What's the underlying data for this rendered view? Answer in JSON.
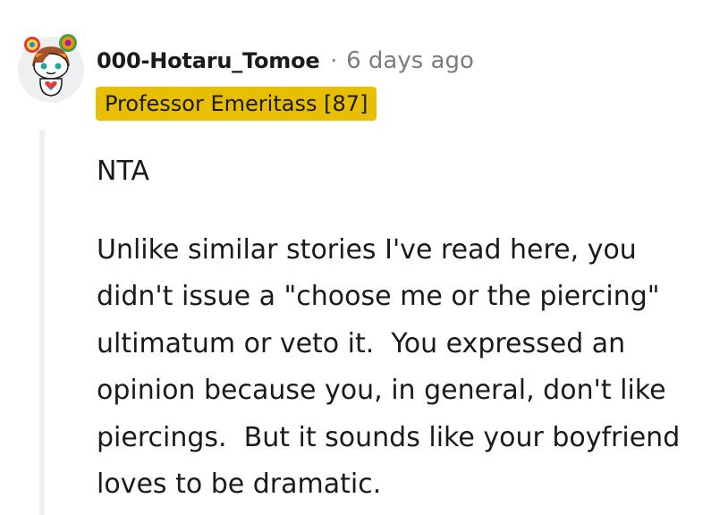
{
  "comment": {
    "author": "000-Hotaru_Tomoe",
    "separator": "·",
    "timestamp": "6 days ago",
    "flair": "Professor Emeritass [87]",
    "paragraphs": [
      "NTA",
      "Unlike similar stories I've read here, you didn't issue a \"choose me or the piercing\" ultimatum or veto it.  You expressed an opinion because you, in general, don't like piercings.  But it sounds like your boyfriend loves to be dramatic."
    ]
  },
  "avatar": {
    "icon": "reddit-snoo-avatar-icon",
    "hair_colors": [
      "#e53935",
      "#fb8c00",
      "#fdd835",
      "#43a047",
      "#1e88e5",
      "#8e24aa"
    ],
    "hat_colors": [
      "#e53935",
      "#fdd835",
      "#43a047",
      "#1e88e5"
    ]
  },
  "colors": {
    "text": "#1a1a1b",
    "meta": "#7c7c7c",
    "flair_bg": "#e8be00",
    "thread_line": "#edeff1",
    "avatar_bg": "#edeff1"
  }
}
